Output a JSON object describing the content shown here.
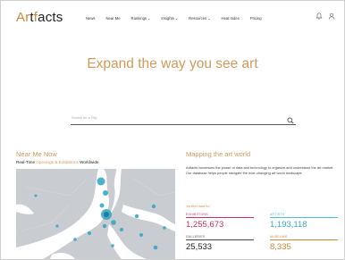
{
  "header": {
    "logo": {
      "part1": "Ar",
      "part2": "t",
      "part3": "f",
      "part4": "acts"
    },
    "nav": [
      {
        "label": "News",
        "dropdown": false
      },
      {
        "label": "Near Me",
        "dropdown": false
      },
      {
        "label": "Rankings",
        "dropdown": true
      },
      {
        "label": "Insights",
        "dropdown": true
      },
      {
        "label": "Resources",
        "dropdown": true
      },
      {
        "label": "Heat Index",
        "dropdown": false
      },
      {
        "label": "Pricing",
        "dropdown": false
      }
    ],
    "icons": [
      "bell-icon",
      "user-icon"
    ]
  },
  "hero": {
    "title": "Expand the way you see art",
    "search_placeholder": "Search for a City"
  },
  "near_me": {
    "title": "Near Me Now",
    "subtitle_prefix": "Real-Time ",
    "subtitle_link": "Openings & Exhibitions",
    "subtitle_suffix": " Worldwide"
  },
  "mapping": {
    "title": "Mapping the art world",
    "description": "Artfacts harnesses the power of data and technology to organize and understand the art market. Our database helps people navigate the ever-changing art world landscape.",
    "verified_label": "Verified data for:",
    "stats": [
      {
        "label": "EXHIBITIONS",
        "value": "1,255,673"
      },
      {
        "label": "ARTISTS",
        "value": "1,193,118"
      },
      {
        "label": "GALLERIES",
        "value": "25,533"
      },
      {
        "label": "MUSEUMS",
        "value": "8,335"
      }
    ]
  },
  "colors": {
    "accent_gold": "#cf9a5b",
    "exhibitions": "#c8325e",
    "artists": "#53b8cf",
    "museums": "#c8893a",
    "map_land": "#c9ccd0",
    "map_water": "#ffffff",
    "map_marker": "#2fa3c2"
  }
}
